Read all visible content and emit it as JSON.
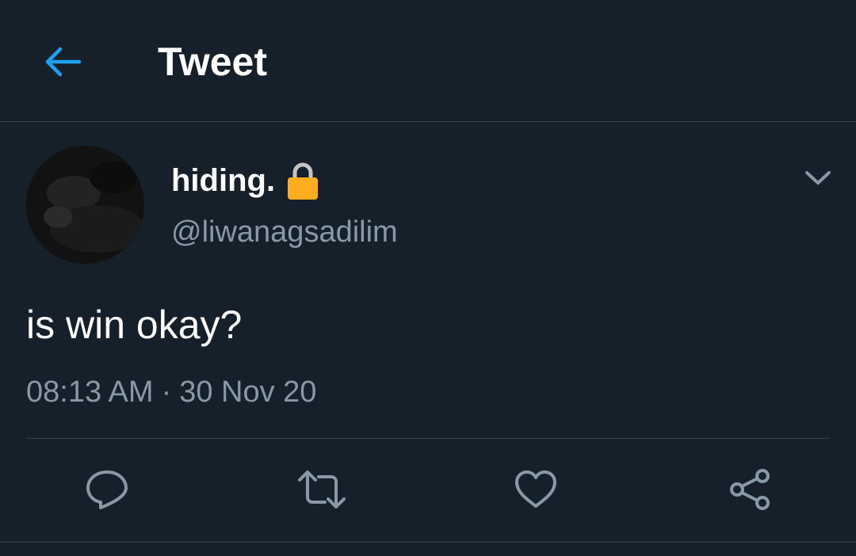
{
  "header": {
    "title": "Tweet",
    "back_icon": "arrow-left-icon"
  },
  "tweet": {
    "display_name": "hiding.",
    "lock_icon": "lock-icon",
    "handle": "@liwanagsadilim",
    "text": "is win okay?",
    "time": "08:13 AM",
    "separator": "·",
    "date": "30 Nov 20",
    "more_icon": "chevron-down-icon"
  },
  "actions": [
    {
      "name": "reply",
      "icon": "reply-icon"
    },
    {
      "name": "retweet",
      "icon": "retweet-icon"
    },
    {
      "name": "like",
      "icon": "heart-icon"
    },
    {
      "name": "share",
      "icon": "share-icon"
    }
  ],
  "colors": {
    "background": "#15202b",
    "accent": "#1da1f2",
    "secondary_text": "#8899a6",
    "divider": "#38444d",
    "lock": "#ffad1f"
  }
}
